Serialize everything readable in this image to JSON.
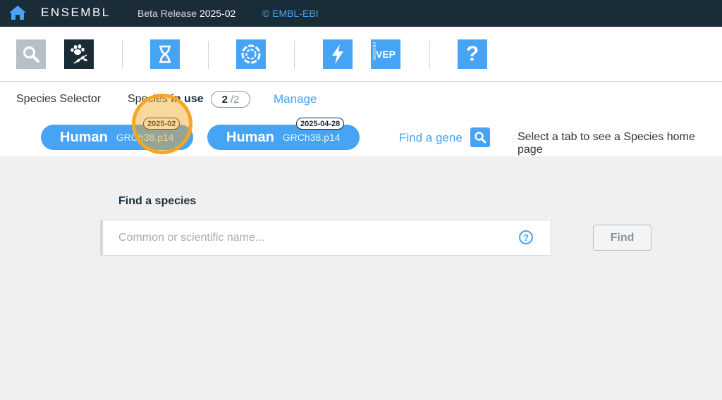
{
  "topbar": {
    "brand": "ENSEMBL",
    "release_label": "Beta Release",
    "release_number": "2025-02",
    "copyright": "© EMBL-EBI"
  },
  "apps": [
    {
      "name": "search-app",
      "icon": "magnifier-icon"
    },
    {
      "name": "species-selector-app",
      "icon": "paw-leaf-icon"
    },
    {
      "name": "genome-browser-app",
      "icon": "dna-helix-icon"
    },
    {
      "name": "tree-app",
      "icon": "circular-tree-icon"
    },
    {
      "name": "blast-app",
      "icon": "lightning-icon"
    },
    {
      "name": "vep-app",
      "label": "VEP",
      "side_label": "ENSEMBL"
    },
    {
      "name": "help-app",
      "label": "?"
    }
  ],
  "species_bar": {
    "selector_label": "Species Selector",
    "in_use_prefix": "Species ",
    "in_use_bold": "in use",
    "count_current": "2",
    "count_total": "/2",
    "manage_label": "Manage",
    "tabs": [
      {
        "name": "Human",
        "assembly": "GRCh38.p14",
        "badge": "2025-02"
      },
      {
        "name": "Human",
        "assembly": "GRCh38.p14",
        "badge": "2025-04-28"
      }
    ],
    "find_gene_label": "Find a gene",
    "hint": "Select a tab to see a Species home page"
  },
  "main": {
    "find_species_title": "Find a species",
    "search_placeholder": "Common or scientific name...",
    "help_label": "?",
    "find_button": "Find"
  },
  "colors": {
    "header_bg": "#1b2c39",
    "accent_blue": "#47a3f3",
    "highlight_orange": "#f5a623"
  }
}
